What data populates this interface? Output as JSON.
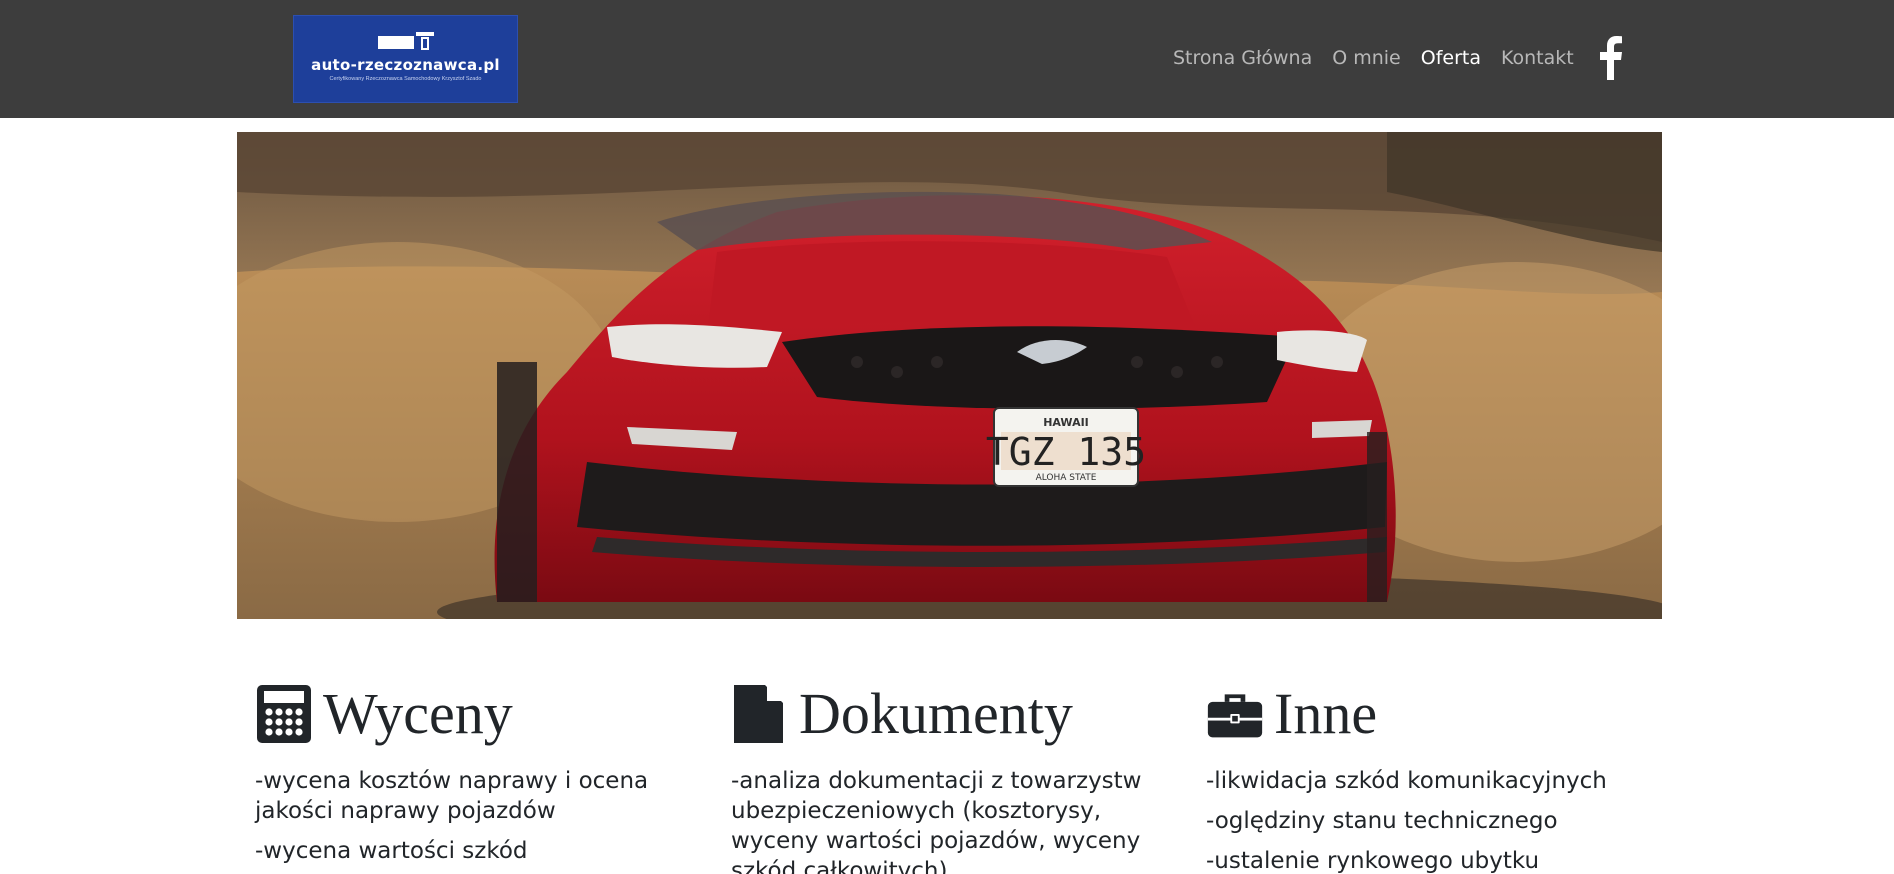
{
  "brand": {
    "name": "auto-rzeczoznawca.pl",
    "tagline": "Certyfikowany Rzeczoznawca Samochodowy Krzysztof Szado",
    "color": "#1e3f9a"
  },
  "nav": {
    "items": [
      {
        "label": "Strona Główna",
        "active": false
      },
      {
        "label": "O mnie",
        "active": false
      },
      {
        "label": "Oferta",
        "active": true
      },
      {
        "label": "Kontakt",
        "active": false
      }
    ],
    "social_icon": "facebook-icon"
  },
  "hero": {
    "image": "red-ford-mustang-convertible",
    "plate_state": "HAWAII",
    "plate_number": "TGZ 135",
    "plate_footer": "ALOHA STATE"
  },
  "offer": [
    {
      "icon": "calculator-icon",
      "title": "Wyceny",
      "items": [
        "-wycena kosztów naprawy i ocena jakości naprawy pojazdów",
        "-wycena wartości szkód"
      ]
    },
    {
      "icon": "document-icon",
      "title": "Dokumenty",
      "items": [
        "-analiza dokumentacji z towarzystw ubezpieczeniowych (kosztorysy, wyceny wartości pojazdów, wyceny szkód całkowitych)"
      ]
    },
    {
      "icon": "briefcase-icon",
      "title": "Inne",
      "items": [
        "-likwidacja szkód komunikacyjnych",
        "-oględziny stanu technicznego",
        "-ustalenie rynkowego ubytku wartości"
      ]
    }
  ],
  "colors": {
    "navbar": "#3d3d3d",
    "nav_text": "#b8b8b8",
    "nav_active": "#ffffff",
    "text": "#212529"
  }
}
